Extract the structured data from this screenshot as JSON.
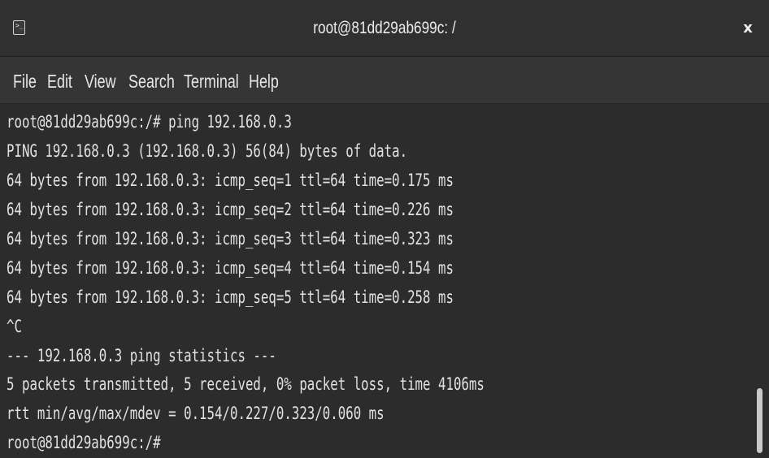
{
  "window": {
    "title": "root@81dd29ab699c: /",
    "close_label": "x",
    "icon": "terminal-icon",
    "icon_glyph": "⊡"
  },
  "menubar": {
    "items": [
      "File",
      "Edit",
      "View",
      "Search",
      "Terminal",
      "Help"
    ]
  },
  "terminal": {
    "lines": [
      "root@81dd29ab699c:/# ping 192.168.0.3",
      "PING 192.168.0.3 (192.168.0.3) 56(84) bytes of data.",
      "64 bytes from 192.168.0.3: icmp_seq=1 ttl=64 time=0.175 ms",
      "64 bytes from 192.168.0.3: icmp_seq=2 ttl=64 time=0.226 ms",
      "64 bytes from 192.168.0.3: icmp_seq=3 ttl=64 time=0.323 ms",
      "64 bytes from 192.168.0.3: icmp_seq=4 ttl=64 time=0.154 ms",
      "64 bytes from 192.168.0.3: icmp_seq=5 ttl=64 time=0.258 ms",
      "^C",
      "--- 192.168.0.3 ping statistics ---",
      "5 packets transmitted, 5 received, 0% packet loss, time 4106ms",
      "rtt min/avg/max/mdev = 0.154/0.227/0.323/0.060 ms",
      "root@81dd29ab699c:/#"
    ]
  },
  "colors": {
    "background": "#2c2c2c",
    "text": "#e2e2e2",
    "titlebar": "#303030",
    "menubar": "#353535"
  }
}
